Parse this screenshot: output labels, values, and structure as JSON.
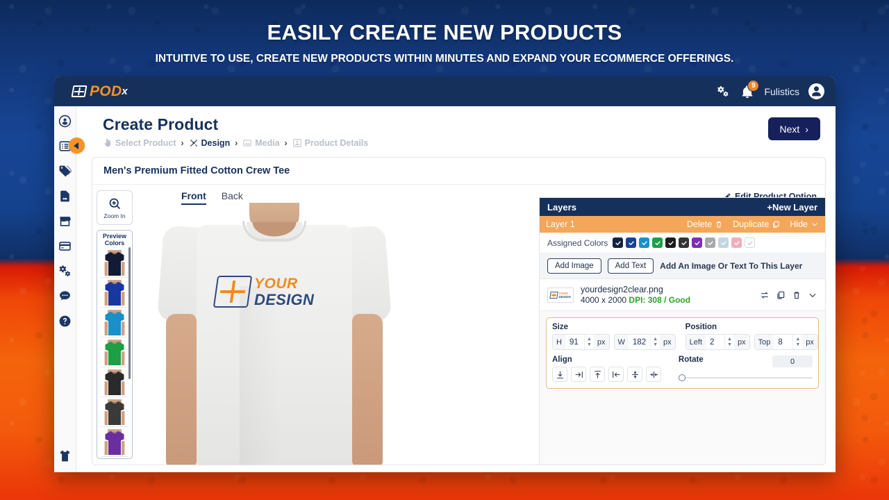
{
  "banner": {
    "headline": "EASILY CREATE NEW PRODUCTS",
    "subhead": "INTUITIVE TO USE, CREATE NEW PRODUCTS WITHIN MINUTES AND EXPAND YOUR ECOMMERCE OFFERINGS."
  },
  "topbar": {
    "logo_pod": "POD",
    "logo_x": "x",
    "notification_count": "9",
    "username": "Fulistics"
  },
  "sidebar": {
    "items": [
      {
        "icon": "user-icon",
        "name": "sidebar-item-account"
      },
      {
        "icon": "list-icon",
        "name": "sidebar-item-orders"
      },
      {
        "icon": "tag-icon",
        "name": "sidebar-item-products"
      },
      {
        "icon": "image-file-icon",
        "name": "sidebar-item-designs"
      },
      {
        "icon": "store-icon",
        "name": "sidebar-item-stores"
      },
      {
        "icon": "card-icon",
        "name": "sidebar-item-billing"
      },
      {
        "icon": "gears-icon",
        "name": "sidebar-item-settings"
      },
      {
        "icon": "chat-icon",
        "name": "sidebar-item-support"
      },
      {
        "icon": "help-icon",
        "name": "sidebar-item-help"
      }
    ],
    "bottom_item": {
      "icon": "tshirt-icon",
      "name": "sidebar-item-catalog"
    }
  },
  "page": {
    "title": "Create Product",
    "breadcrumbs": [
      {
        "label": "Select Product",
        "icon": "hand-pointer-icon",
        "active": false
      },
      {
        "label": "Design",
        "icon": "design-tools-icon",
        "active": true
      },
      {
        "label": "Media",
        "icon": "photo-icon",
        "active": false
      },
      {
        "label": "Product Details",
        "icon": "details-icon",
        "active": false
      }
    ],
    "separator": "›",
    "next_button": "Next",
    "next_chevron": "›"
  },
  "product": {
    "name": "Men's Premium Fitted Cotton Crew Tee",
    "zoom_button": "Zoom In",
    "preview_colors_label_line1": "Preview",
    "preview_colors_label_line2": "Colors",
    "preview_colors": [
      "#111b33",
      "#1a37a0",
      "#1b8fc8",
      "#1f9e46",
      "#2a2a2a",
      "#3a3a38",
      "#6a2ea0"
    ],
    "views": [
      {
        "label": "Front",
        "active": true
      },
      {
        "label": "Back",
        "active": false
      }
    ],
    "edit_option": "Edit Product Option",
    "design_text_top": "YOUR",
    "design_text_bottom": "DESIGN"
  },
  "layers_panel": {
    "title": "Layers",
    "new_layer": "+New Layer",
    "layer_name": "Layer 1",
    "delete": "Delete",
    "duplicate": "Duplicate",
    "hide": "Hide",
    "assigned_colors_label": "Assigned Colors",
    "assigned_colors": [
      {
        "hex": "#16233f",
        "check": "#ffffff"
      },
      {
        "hex": "#17429a",
        "check": "#ffffff"
      },
      {
        "hex": "#1b8fc8",
        "check": "#ffffff"
      },
      {
        "hex": "#1f9e46",
        "check": "#ffffff"
      },
      {
        "hex": "#1c1c1c",
        "check": "#ffffff"
      },
      {
        "hex": "#343434",
        "check": "#ffffff"
      },
      {
        "hex": "#7a2fb5",
        "check": "#ffffff"
      },
      {
        "hex": "#a6a8ac",
        "check": "#ffffff"
      },
      {
        "hex": "#c3d4e2",
        "check": "#ffffff"
      },
      {
        "hex": "#f0aebd",
        "check": "#ffffff"
      },
      {
        "hex": "#ffffff",
        "check": "#c9ccd3"
      }
    ],
    "add_image": "Add Image",
    "add_text": "Add Text",
    "add_hint": "Add An Image Or Text To This Layer",
    "file": {
      "name": "yourdesign2clear.png",
      "dimensions": "4000 x 2000",
      "dpi": "DPI: 308 / Good",
      "thumb_text_top": "YOUR",
      "thumb_text_bottom": "DESIGN"
    },
    "properties": {
      "size_label": "Size",
      "position_label": "Position",
      "align_label": "Align",
      "rotate_label": "Rotate",
      "height_key": "H",
      "height_value": "91",
      "width_key": "W",
      "width_value": "182",
      "left_key": "Left",
      "left_value": "2",
      "top_key": "Top",
      "top_value": "8",
      "unit": "px",
      "rotate_value": "0",
      "align_buttons": [
        "align-bottom-icon",
        "align-right-icon",
        "align-top-icon",
        "align-left-icon",
        "center-vertical-icon",
        "center-horizontal-icon"
      ]
    }
  }
}
